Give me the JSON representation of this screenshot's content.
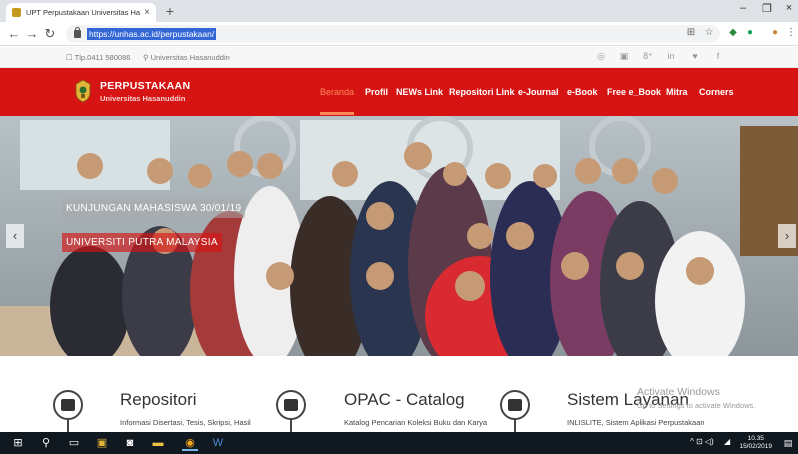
{
  "browser": {
    "tab_title": "UPT Perpustakaan Universitas Ha",
    "tab_close": "×",
    "new_tab": "+",
    "url": "https://unhas.ac.id/perpustakaan/",
    "window_controls": [
      "–",
      "❐",
      "×"
    ]
  },
  "infobar": {
    "phone": "Tlp.0411 580086",
    "location": "Universitas Hasanuddin",
    "social_icons": [
      "instagram-icon",
      "youtube-icon",
      "google-plus-icon",
      "linkedin-icon",
      "twitter-icon",
      "facebook-icon"
    ],
    "social_glyphs": [
      "◎",
      "▣",
      "8⁺",
      "in",
      "♥",
      "f"
    ]
  },
  "header": {
    "brand_title": "PERPUSTAKAAN",
    "brand_subtitle": "Universitas Hasanuddin",
    "menu": [
      "Beranda",
      "Profil",
      "NEWs Link",
      "Repositori Link",
      "e-Journal",
      "e-Book",
      "Free e_Book",
      "Mitra",
      "Corners"
    ],
    "active_menu": "Beranda",
    "bg_color": "#d61414"
  },
  "hero": {
    "caption_line1": "KUNJUNGAN MAHASISWA 30/01/19",
    "caption_line2": "UNIVERSITI PUTRA MALAYSIA",
    "prev": "‹",
    "next": "›"
  },
  "services": [
    {
      "title": "Repositori",
      "desc": "Informasi Disertasi, Tesis, Skripsi, Hasil",
      "icon": "monitor-icon"
    },
    {
      "title": "OPAC - Catalog",
      "desc": "Katalog Pencarian Koleksi Buku dan Karya",
      "icon": "folder-icon"
    },
    {
      "title": "Sistem Layanan",
      "desc": "INLISLITE, Sistem Aplikasi Perpustakaan",
      "icon": "car-icon"
    }
  ],
  "watermark": {
    "line1": "Activate Windows",
    "line2": "Go to Settings to activate Windows."
  },
  "taskbar": {
    "time": "10.35",
    "date": "15/02/2019"
  }
}
